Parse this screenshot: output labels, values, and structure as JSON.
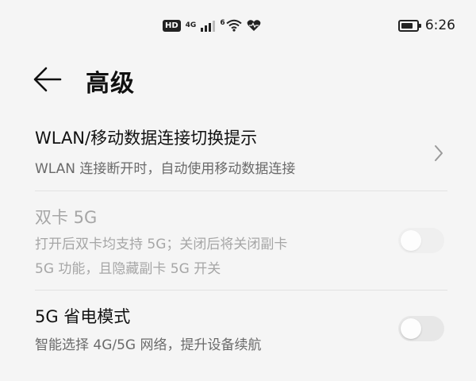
{
  "status_bar": {
    "hd_label": "HD",
    "network_type": "4G",
    "wifi_label": "6",
    "time": "6:26",
    "signal_level": 0.75,
    "battery_level": 0.8
  },
  "header": {
    "back_icon": "arrow-left-icon",
    "title": "高级"
  },
  "settings": [
    {
      "title": "WLAN/移动数据连接切换提示",
      "description": [
        "WLAN 连接断开时，自动使用移动数据连接"
      ],
      "control": "chevron",
      "enabled": true
    },
    {
      "title": "双卡 5G",
      "description": [
        "打开后双卡均支持 5G；关闭后将关闭副卡",
        "5G 功能，且隐藏副卡 5G 开关"
      ],
      "control": "toggle",
      "toggle_on": false,
      "enabled": false
    },
    {
      "title": "5G 省电模式",
      "description": [
        "智能选择 4G/5G 网络，提升设备续航"
      ],
      "control": "toggle",
      "toggle_on": false,
      "enabled": true
    }
  ],
  "colors": {
    "background": "#f5f5f5",
    "title_text": "#111111",
    "secondary_text": "#6a6a6a",
    "disabled_text": "#a6a6a6",
    "toggle_off_track": "#e7e7e7"
  }
}
